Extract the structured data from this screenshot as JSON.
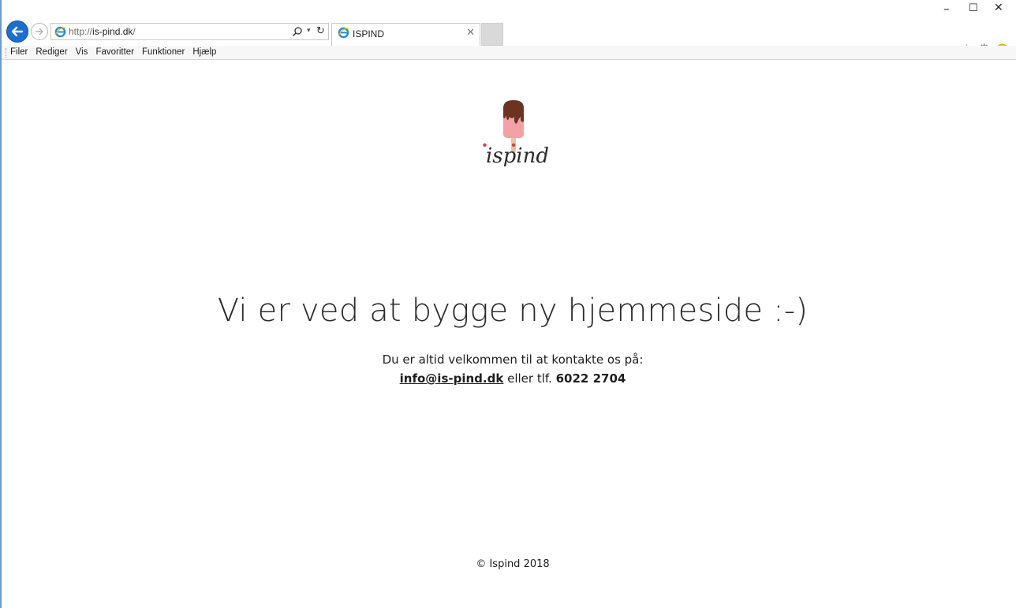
{
  "browser": {
    "address": {
      "prefix": "http://",
      "domain": "is-pind.dk",
      "suffix": "/"
    },
    "tab": {
      "title": "ISPIND"
    },
    "menu": [
      "Filer",
      "Rediger",
      "Vis",
      "Favoritter",
      "Funktioner",
      "Hjælp"
    ],
    "window_controls": {
      "minimize": "–",
      "maximize": "☐",
      "close": "✕"
    }
  },
  "page": {
    "logo_text": "ispind",
    "headline": "Vi er ved at bygge ny hjemmeside :-)",
    "contact_line1": "Du er altid velkommen til at kontakte os på:",
    "email": "info@is-pind.dk",
    "phone_prefix": "eller tlf.",
    "phone": "6022 2704",
    "footer": "© Ispind 2018"
  }
}
